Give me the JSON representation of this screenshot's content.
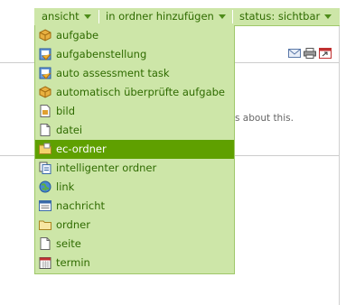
{
  "topbar": {
    "ansicht": "ansicht",
    "add": "in ordner hinzufügen",
    "status": "status: sichtbar"
  },
  "background": {
    "text": "s about this."
  },
  "menu": {
    "items": [
      {
        "label": "aufgabe",
        "icon": "package-icon"
      },
      {
        "label": "aufgabenstellung",
        "icon": "assignment-icon"
      },
      {
        "label": "auto assessment task",
        "icon": "assignment-icon"
      },
      {
        "label": "automatisch überprüfte aufgabe",
        "icon": "package-icon"
      },
      {
        "label": "bild",
        "icon": "image-icon"
      },
      {
        "label": "datei",
        "icon": "file-icon"
      },
      {
        "label": "ec-ordner",
        "icon": "folder-icon",
        "selected": true
      },
      {
        "label": "intelligenter ordner",
        "icon": "smart-folder-icon"
      },
      {
        "label": "link",
        "icon": "link-icon"
      },
      {
        "label": "nachricht",
        "icon": "news-icon"
      },
      {
        "label": "ordner",
        "icon": "folder-icon"
      },
      {
        "label": "seite",
        "icon": "page-icon"
      },
      {
        "label": "termin",
        "icon": "calendar-icon"
      }
    ]
  },
  "colors": {
    "menu_bg": "#cde6a8",
    "menu_text": "#2f6b00",
    "selected_bg": "#5fa000"
  }
}
